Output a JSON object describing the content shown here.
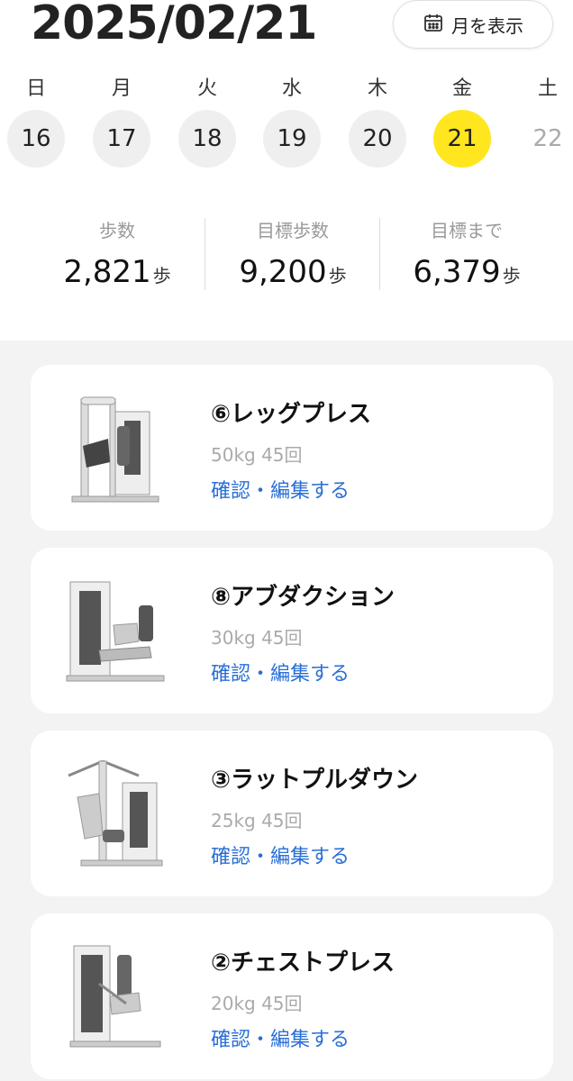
{
  "header": {
    "date": "2025/02/21",
    "month_button_label": "月を表示"
  },
  "week": [
    {
      "dow": "日",
      "num": "16"
    },
    {
      "dow": "月",
      "num": "17"
    },
    {
      "dow": "火",
      "num": "18"
    },
    {
      "dow": "水",
      "num": "19"
    },
    {
      "dow": "木",
      "num": "20"
    },
    {
      "dow": "金",
      "num": "21"
    },
    {
      "dow": "土",
      "num": "22"
    }
  ],
  "selected_day": "21",
  "colors": {
    "selected": "#ffe61f",
    "link": "#2a6fd6"
  },
  "stats": [
    {
      "label": "歩数",
      "value": "2,821",
      "unit": "歩"
    },
    {
      "label": "目標歩数",
      "value": "9,200",
      "unit": "歩"
    },
    {
      "label": "目標まで",
      "value": "6,379",
      "unit": "歩"
    }
  ],
  "workouts": [
    {
      "title": "⑥レッグプレス",
      "detail": "50kg 45回",
      "link": "確認・編集する",
      "icon": "leg-press-machine"
    },
    {
      "title": "⑧アブダクション",
      "detail": "30kg 45回",
      "link": "確認・編集する",
      "icon": "abduction-machine"
    },
    {
      "title": "③ラットプルダウン",
      "detail": "25kg 45回",
      "link": "確認・編集する",
      "icon": "lat-pulldown-machine"
    },
    {
      "title": "②チェストプレス",
      "detail": "20kg 45回",
      "link": "確認・編集する",
      "icon": "chest-press-machine"
    }
  ]
}
